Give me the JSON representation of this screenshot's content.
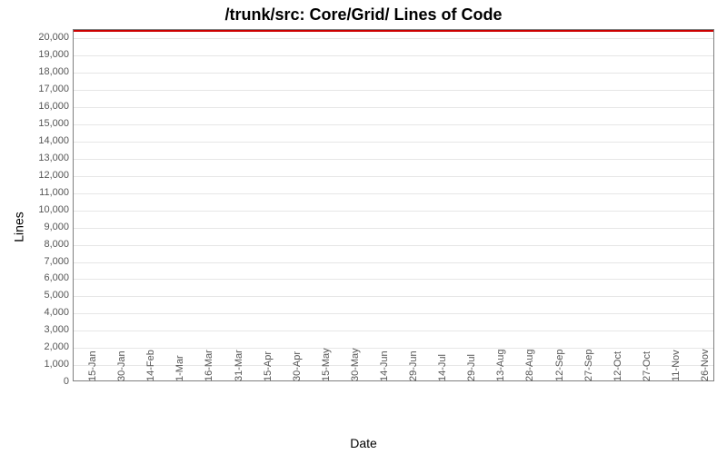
{
  "chart_data": {
    "type": "line",
    "title": "/trunk/src: Core/Grid/ Lines of Code",
    "xlabel": "Date",
    "ylabel": "Lines",
    "ylim": [
      0,
      20500
    ],
    "y_ticks": [
      0,
      1000,
      2000,
      3000,
      4000,
      5000,
      6000,
      7000,
      8000,
      9000,
      10000,
      11000,
      12000,
      13000,
      14000,
      15000,
      16000,
      17000,
      18000,
      19000,
      20000
    ],
    "y_tick_labels": [
      "0",
      "1,000",
      "2,000",
      "3,000",
      "4,000",
      "5,000",
      "6,000",
      "7,000",
      "8,000",
      "9,000",
      "10,000",
      "11,000",
      "12,000",
      "13,000",
      "14,000",
      "15,000",
      "16,000",
      "17,000",
      "18,000",
      "19,000",
      "20,000"
    ],
    "categories": [
      "15-Jan",
      "30-Jan",
      "14-Feb",
      "1-Mar",
      "16-Mar",
      "31-Mar",
      "15-Apr",
      "30-Apr",
      "15-May",
      "30-May",
      "14-Jun",
      "29-Jun",
      "14-Jul",
      "29-Jul",
      "13-Aug",
      "28-Aug",
      "12-Sep",
      "27-Sep",
      "12-Oct",
      "27-Oct",
      "11-Nov",
      "26-Nov"
    ],
    "series": [
      {
        "name": "Lines of Code",
        "color": "#cc0000",
        "values": [
          20500,
          20500,
          20500,
          20500,
          20500,
          20500,
          20500,
          20500,
          20500,
          20500,
          20500,
          20500,
          20500,
          20500,
          20500,
          20500,
          20500,
          20500,
          20500,
          20500,
          20500,
          20500
        ]
      }
    ]
  }
}
